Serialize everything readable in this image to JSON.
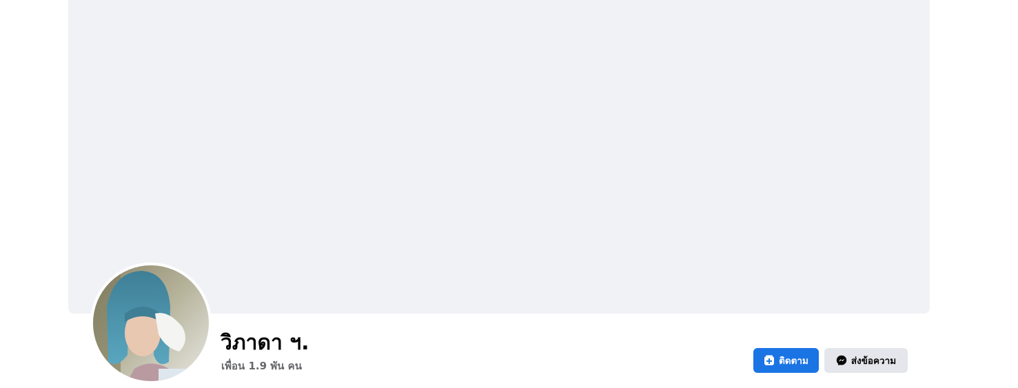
{
  "profile": {
    "name": "วิภาดา ฯ.",
    "friends_count": "เพื่อน 1.9 พัน คน"
  },
  "actions": {
    "follow_label": "ติดตาม",
    "follow_icon": "follow-plus-icon",
    "message_label": "ส่งข้อความ",
    "message_icon": "messenger-icon"
  },
  "colors": {
    "follow_button": "#1b74e4",
    "message_button": "#e4e6eb",
    "cover_placeholder": "#f0f2f5",
    "secondary_text": "#65676b"
  }
}
